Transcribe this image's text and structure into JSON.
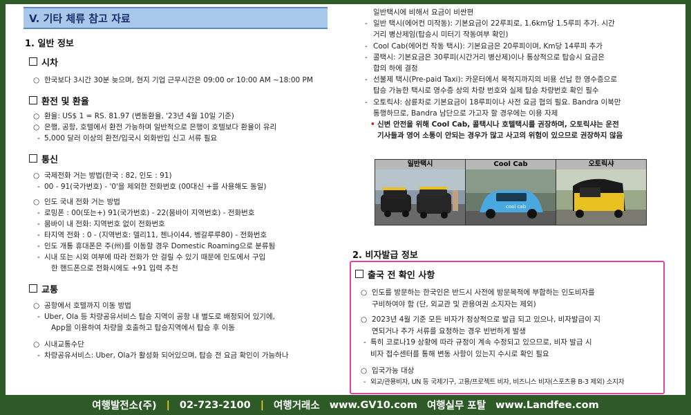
{
  "section_title": "V. 기타 체류 참고 자료",
  "general": {
    "heading": "1. 일반 정보",
    "timezone": {
      "title": "시차",
      "items": [
        "한국보다 3시간 30분 늦으며, 현지 기업 근무시간은 09:00 or 10:00 AM ~18:00 PM"
      ]
    },
    "exchange": {
      "title": "환전 및 환율",
      "items": [
        "환율: US$ 1 = RS. 81.97 (변동환율, '23년 4월 10일 기준)",
        "은행, 공항, 호텔에서 환전 가능하며 일반적으로 은행이 호텔보다 환율이 유리"
      ],
      "dash": [
        "5,000 달러 이상의 환전/입국시 외화반입 신고 서류 필요"
      ]
    },
    "telecom": {
      "title": "통신",
      "intl": "국제전화 거는 방법(한국 : 82, 인도 : 91)",
      "intl_dash": "00 - 91(국가번호) - '0'을 제외한 전화번호 (00대신 +를 사용해도 동일)",
      "domestic": "인도 국내 전화 거는 방법",
      "domestic_dash": [
        "로밍폰 : 00(또는+) 91(국가번호) - 22(뭄바이 지역번호) - 전화번호",
        "뭄바이 내 전화: 지역번호 없이 전화번호",
        "타지역 전화 : 0 - (지역번호: 델리11, 첸나이44, 벵갈루루80) - 전화번호",
        "인도 개통 휴대폰은 주(州)를 이동할 경우 Domestic Roaming으로 분류됨",
        "시내 또는 시외 여부에 따라 전화가 안 걸릴 수 있기 때문에 인도에서 구입",
        "한 핸드폰으로 전화시에도 +91 입력 추천"
      ]
    },
    "transport": {
      "title": "교통",
      "airport": "공항에서 호텔까지 이동 방법",
      "airport_dash": [
        "Uber, Ola 등 차량공유서비스 탑승 지역이 공항 내 별도로 배정되어 있기에,",
        "App을 이용하여 차량을 호출하고 탑승지역에서 탑승 후 이동"
      ],
      "city": "시내교통수단",
      "city_dash": "차량공유서비스: Uber, Ola가 활성화 되어있으며, 탑승 전 요금 확인이 가능하나"
    }
  },
  "right": {
    "cont_line": "일반택시에 비해서 요금이 비싼편",
    "taxi_items": [
      [
        "일반 택시(에어컨 미작동): 기본요금이 22루피로, 1.6km당 1.5루피 추가. 시간",
        "거리 병산제임(탑승시 미터기 작동여부 확인)"
      ],
      [
        "Cool Cab(에어컨 작동 택시): 기본요금은 20루피이며, Km당 14루피 추가"
      ],
      [
        "콜택시: 기본요금은 30루피(시간거리 병산제)이나 통상적으로 탑승시 요금은",
        "합의 하에 결정"
      ],
      [
        "선불제 택시(Pre-paid Taxi): 카운터에서 목적지까지의 비용 선납 한 영수증으로",
        "탑승 가능한 택시로 영수증 상의 차량 번호와 실제 탑승 차량번호 확인 필수"
      ],
      [
        "오토릭샤: 삼륜차로 기본요금이 18루피이나 사전 요금 협의 필요. Bandra 이북만",
        "통행하므로, Bandra 남단으로 가고자 할 경우에는 이용 자제"
      ]
    ],
    "note": [
      "신변 안전을 위해 Cool Cab, 콜택시나 호텔택시를 권장하며, 오토릭샤는 운전",
      "기사들과 영어 소통이 안되는 경우가 많고 사고의 위험이 있으므로 권장하지 않음"
    ],
    "photos": [
      "일반택시",
      "Cool Cab",
      "오토릭샤"
    ],
    "visa_heading": "2. 비자발급 정보",
    "visa_box_title": "출국 전 확인 사항",
    "visa_items": [
      [
        "인도를 방문하는 한국인은 반드시 사전에 방문목적에 부합하는 인도비자를",
        "구비하여야 함 (단, 외교관 및 관용여권 소지자는 제외)"
      ],
      [
        "2023년 4월 기준 모든 비자가 정상적으로 발급 되고 있으나, 비자발급이 지",
        "연되거나 추가 서류를 요청하는 경우 빈번하게 발생"
      ]
    ],
    "visa_dash": [
      "특히 코로나19 상황에 따라 규정이 계속 수정되고 있으므로, 비자 발급 시",
      "비자 접수센터를 통해 변동 사항이 있는지 수시로 확인 필요"
    ],
    "entry_item": "입국가능 대상",
    "entry_dash": "외교/관용비자, UN 등 국제기구, 고용/프로젝트 비자, 비즈니스 비자(스포츠용 B-3 제외) 소지자"
  },
  "footer": {
    "company": "여행발전소(주)",
    "phone": "02-723-2100",
    "exchange_label": "여행거래소",
    "exchange_url": "www.GV10.com",
    "portal_label": "여행실무 포탈",
    "portal_url": "www.Landfee.com",
    "separator": "|"
  },
  "colors": {
    "banner": "#a8c8ea",
    "frame": "#2d5a27",
    "highlight_box": "#e040a0"
  }
}
